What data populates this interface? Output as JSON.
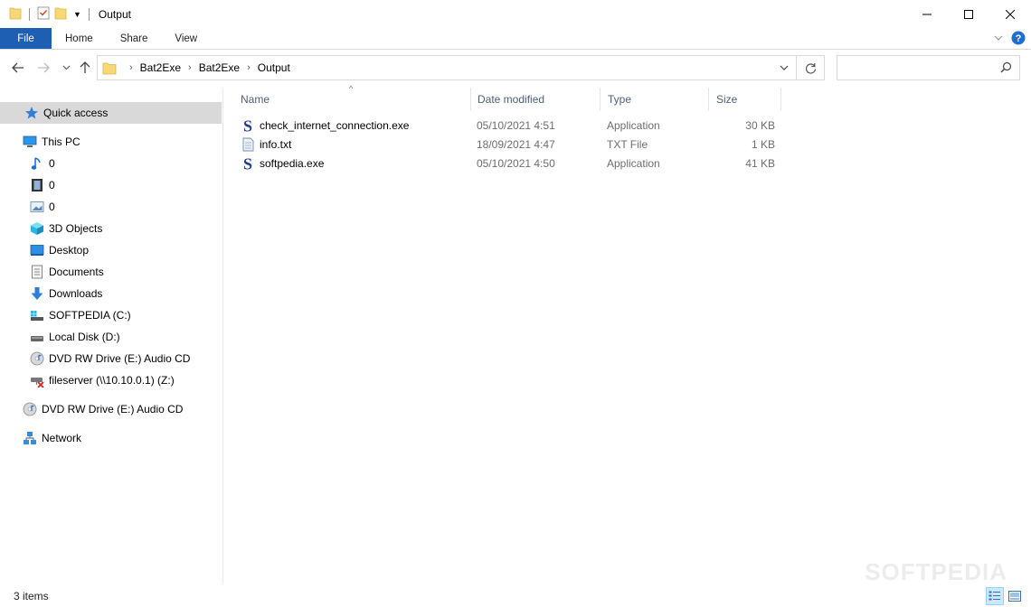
{
  "window": {
    "title": "Output"
  },
  "ribbon": {
    "tabs": [
      {
        "label": "File"
      },
      {
        "label": "Home"
      },
      {
        "label": "Share"
      },
      {
        "label": "View"
      }
    ]
  },
  "address": {
    "breadcrumbs": [
      "Bat2Exe",
      "Bat2Exe",
      "Output"
    ],
    "search_placeholder": ""
  },
  "nav": {
    "quick_access": "Quick access",
    "this_pc": "This PC",
    "items": [
      {
        "label": "0",
        "icon": "music-icon"
      },
      {
        "label": "0",
        "icon": "video-icon"
      },
      {
        "label": "0",
        "icon": "picture-icon"
      },
      {
        "label": "3D Objects",
        "icon": "cube-icon"
      },
      {
        "label": "Desktop",
        "icon": "desktop-icon"
      },
      {
        "label": "Documents",
        "icon": "document-icon"
      },
      {
        "label": "Downloads",
        "icon": "download-icon"
      },
      {
        "label": "SOFTPEDIA (C:)",
        "icon": "system-drive-icon"
      },
      {
        "label": "Local Disk (D:)",
        "icon": "drive-icon"
      },
      {
        "label": "DVD RW Drive (E:) Audio CD",
        "icon": "cd-icon"
      },
      {
        "label": "fileserver (\\\\10.10.0.1) (Z:)",
        "icon": "network-drive-disconnected-icon"
      }
    ],
    "dvd_root": "DVD RW Drive (E:) Audio CD",
    "network": "Network"
  },
  "columns": {
    "name": "Name",
    "date": "Date modified",
    "type": "Type",
    "size": "Size"
  },
  "files": [
    {
      "name": "check_internet_connection.exe",
      "date": "05/10/2021 4:51",
      "type": "Application",
      "size": "30 KB",
      "icon": "softpedia-app-icon"
    },
    {
      "name": "info.txt",
      "date": "18/09/2021 4:47",
      "type": "TXT File",
      "size": "1 KB",
      "icon": "text-file-icon"
    },
    {
      "name": "softpedia.exe",
      "date": "05/10/2021 4:50",
      "type": "Application",
      "size": "41 KB",
      "icon": "softpedia-app-icon"
    }
  ],
  "status": {
    "item_count": "3 items"
  },
  "watermark": "SOFTPEDIA",
  "colors": {
    "file_tab": "#1e5fb4",
    "selected_nav": "#d9d9d9",
    "header_text": "#4c607a",
    "folder": "#f8d775"
  }
}
